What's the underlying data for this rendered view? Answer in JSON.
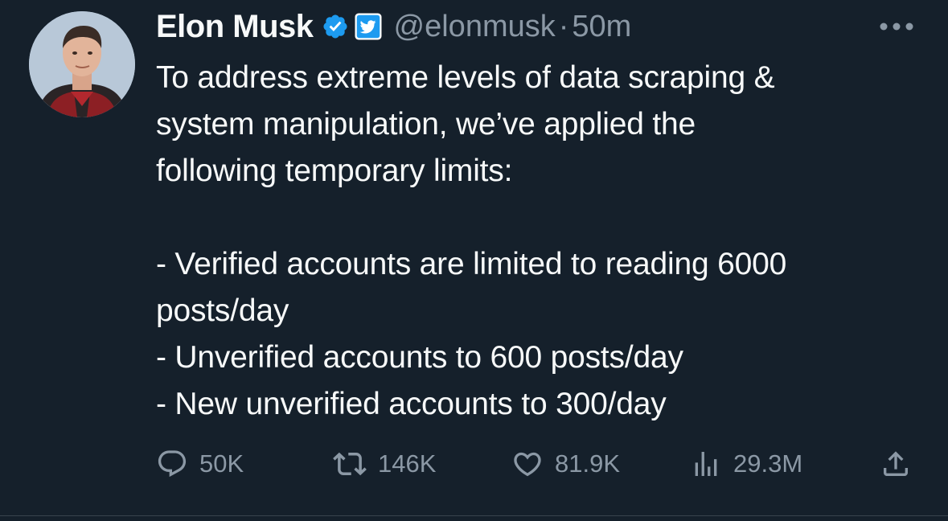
{
  "author": {
    "display_name": "Elon Musk",
    "handle": "@elonmusk",
    "separator": "·",
    "time": "50m",
    "verified": true
  },
  "tweet": {
    "text": "To address extreme levels of data scraping &\nsystem manipulation, we’ve applied the\nfollowing temporary limits:\n\n- Verified accounts are limited to reading 6000\nposts/day\n- Unverified accounts to 600 posts/day\n- New unverified accounts to 300/day"
  },
  "actions": {
    "replies": "50K",
    "retweets": "146K",
    "likes": "81.9K",
    "views": "29.3M"
  },
  "icons": {
    "avatar": "profile-photo",
    "verified": "verified-badge-icon",
    "affiliate": "twitter-bird-icon",
    "more": "more-dots-icon",
    "reply": "reply-icon",
    "retweet": "retweet-icon",
    "like": "heart-icon",
    "views": "views-chart-icon",
    "share": "share-icon"
  },
  "colors": {
    "background": "#15202b",
    "text_primary": "#f7f9f9",
    "text_secondary": "#8b98a5",
    "verified_blue": "#1d9bf0"
  }
}
